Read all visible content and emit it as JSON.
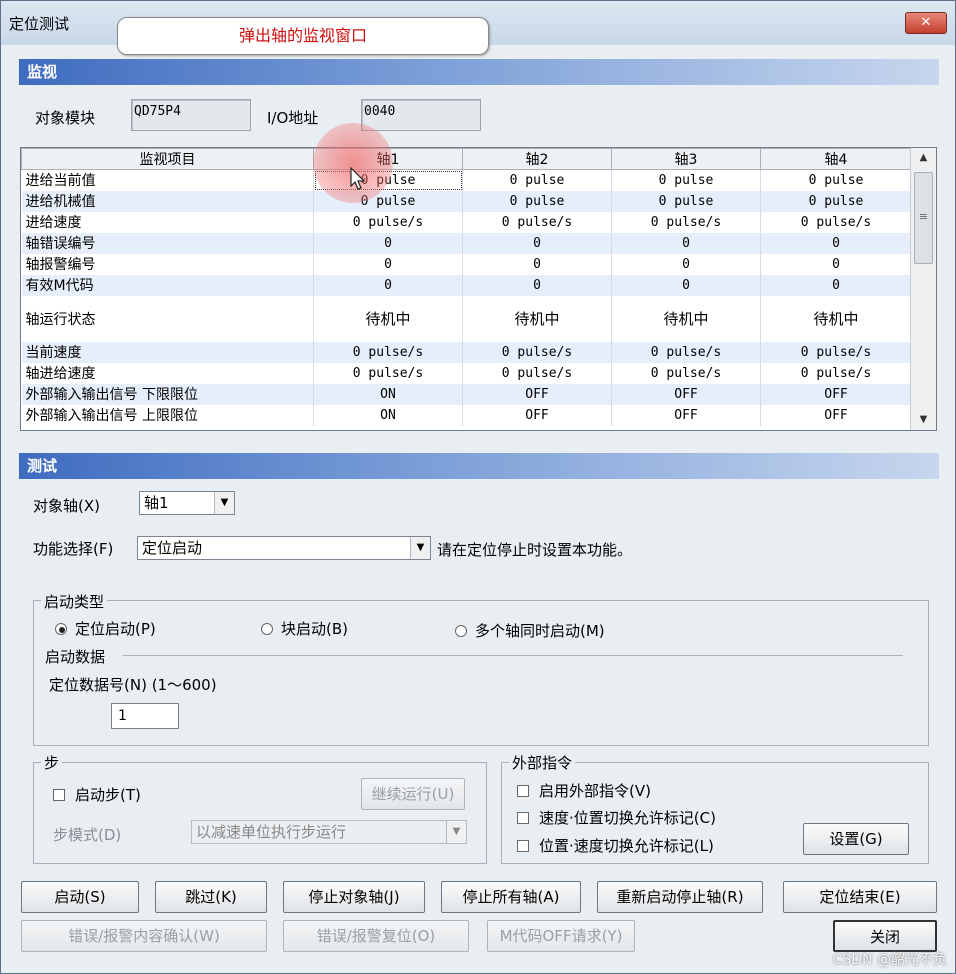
{
  "window": {
    "title": "定位测试",
    "close_glyph": "✕"
  },
  "callout": "弹出轴的监视窗口",
  "monitor": {
    "section_title": "监视",
    "module_label": "对象模块",
    "module_value": "QD75P4",
    "io_label": "I/O地址",
    "io_value": "0040",
    "columns": [
      "监视项目",
      "轴1",
      "轴2",
      "轴3",
      "轴4"
    ],
    "rows": [
      {
        "item": "进给当前值",
        "v": [
          "0 pulse",
          "0 pulse",
          "0 pulse",
          "0 pulse"
        ]
      },
      {
        "item": "进给机械值",
        "v": [
          "0 pulse",
          "0 pulse",
          "0 pulse",
          "0 pulse"
        ]
      },
      {
        "item": "进给速度",
        "v": [
          "0 pulse/s",
          "0 pulse/s",
          "0 pulse/s",
          "0 pulse/s"
        ]
      },
      {
        "item": "轴错误编号",
        "v": [
          "0",
          "0",
          "0",
          "0"
        ]
      },
      {
        "item": "轴报警编号",
        "v": [
          "0",
          "0",
          "0",
          "0"
        ]
      },
      {
        "item": "有效M代码",
        "v": [
          "0",
          "0",
          "0",
          "0"
        ]
      },
      {
        "item": "轴运行状态",
        "v": [
          "待机中",
          "待机中",
          "待机中",
          "待机中"
        ]
      },
      {
        "item": "当前速度",
        "v": [
          "0 pulse/s",
          "0 pulse/s",
          "0 pulse/s",
          "0 pulse/s"
        ]
      },
      {
        "item": "轴进给速度",
        "v": [
          "0 pulse/s",
          "0 pulse/s",
          "0 pulse/s",
          "0 pulse/s"
        ]
      },
      {
        "item": "外部输入输出信号 下限限位",
        "v": [
          "ON",
          "OFF",
          "OFF",
          "OFF"
        ]
      },
      {
        "item": "外部输入输出信号 上限限位",
        "v": [
          "ON",
          "OFF",
          "OFF",
          "OFF"
        ]
      }
    ]
  },
  "test": {
    "section_title": "测试",
    "axis_label": "对象轴(X)",
    "axis_value": "轴1",
    "function_label": "功能选择(F)",
    "function_value": "定位启动",
    "function_hint": "请在定位停止时设置本功能。",
    "start_type": {
      "title": "启动类型",
      "options": [
        "定位启动(P)",
        "块启动(B)",
        "多个轴同时启动(M)"
      ],
      "selected": "定位启动(P)",
      "data_title": "启动数据",
      "data_no_label": "定位数据号(N) (1～600)",
      "data_no_value": "1"
    },
    "step": {
      "title": "步",
      "checkbox": "启动步(T)",
      "continue_button": "继续运行(U)",
      "mode_label": "步模式(D)",
      "mode_value": "以减速单位执行步运行"
    },
    "external": {
      "title": "外部指令",
      "checks": [
        "启用外部指令(V)",
        "速度·位置切换允许标记(C)",
        "位置·速度切换允许标记(L)"
      ],
      "settings_button": "设置(G)"
    }
  },
  "buttons": {
    "row1": [
      "启动(S)",
      "跳过(K)",
      "停止对象轴(J)",
      "停止所有轴(A)",
      "重新启动停止轴(R)",
      "定位结束(E)"
    ],
    "row2": [
      "错误/报警内容确认(W)",
      "错误/报警复位(O)",
      "M代码OFF请求(Y)"
    ],
    "close": "关闭"
  },
  "watermark": "CSDN @韶光不负",
  "colors": {
    "section_header": "#3f6cc0",
    "callout_text": "#d01010",
    "alt_row": "#e6eefb"
  }
}
